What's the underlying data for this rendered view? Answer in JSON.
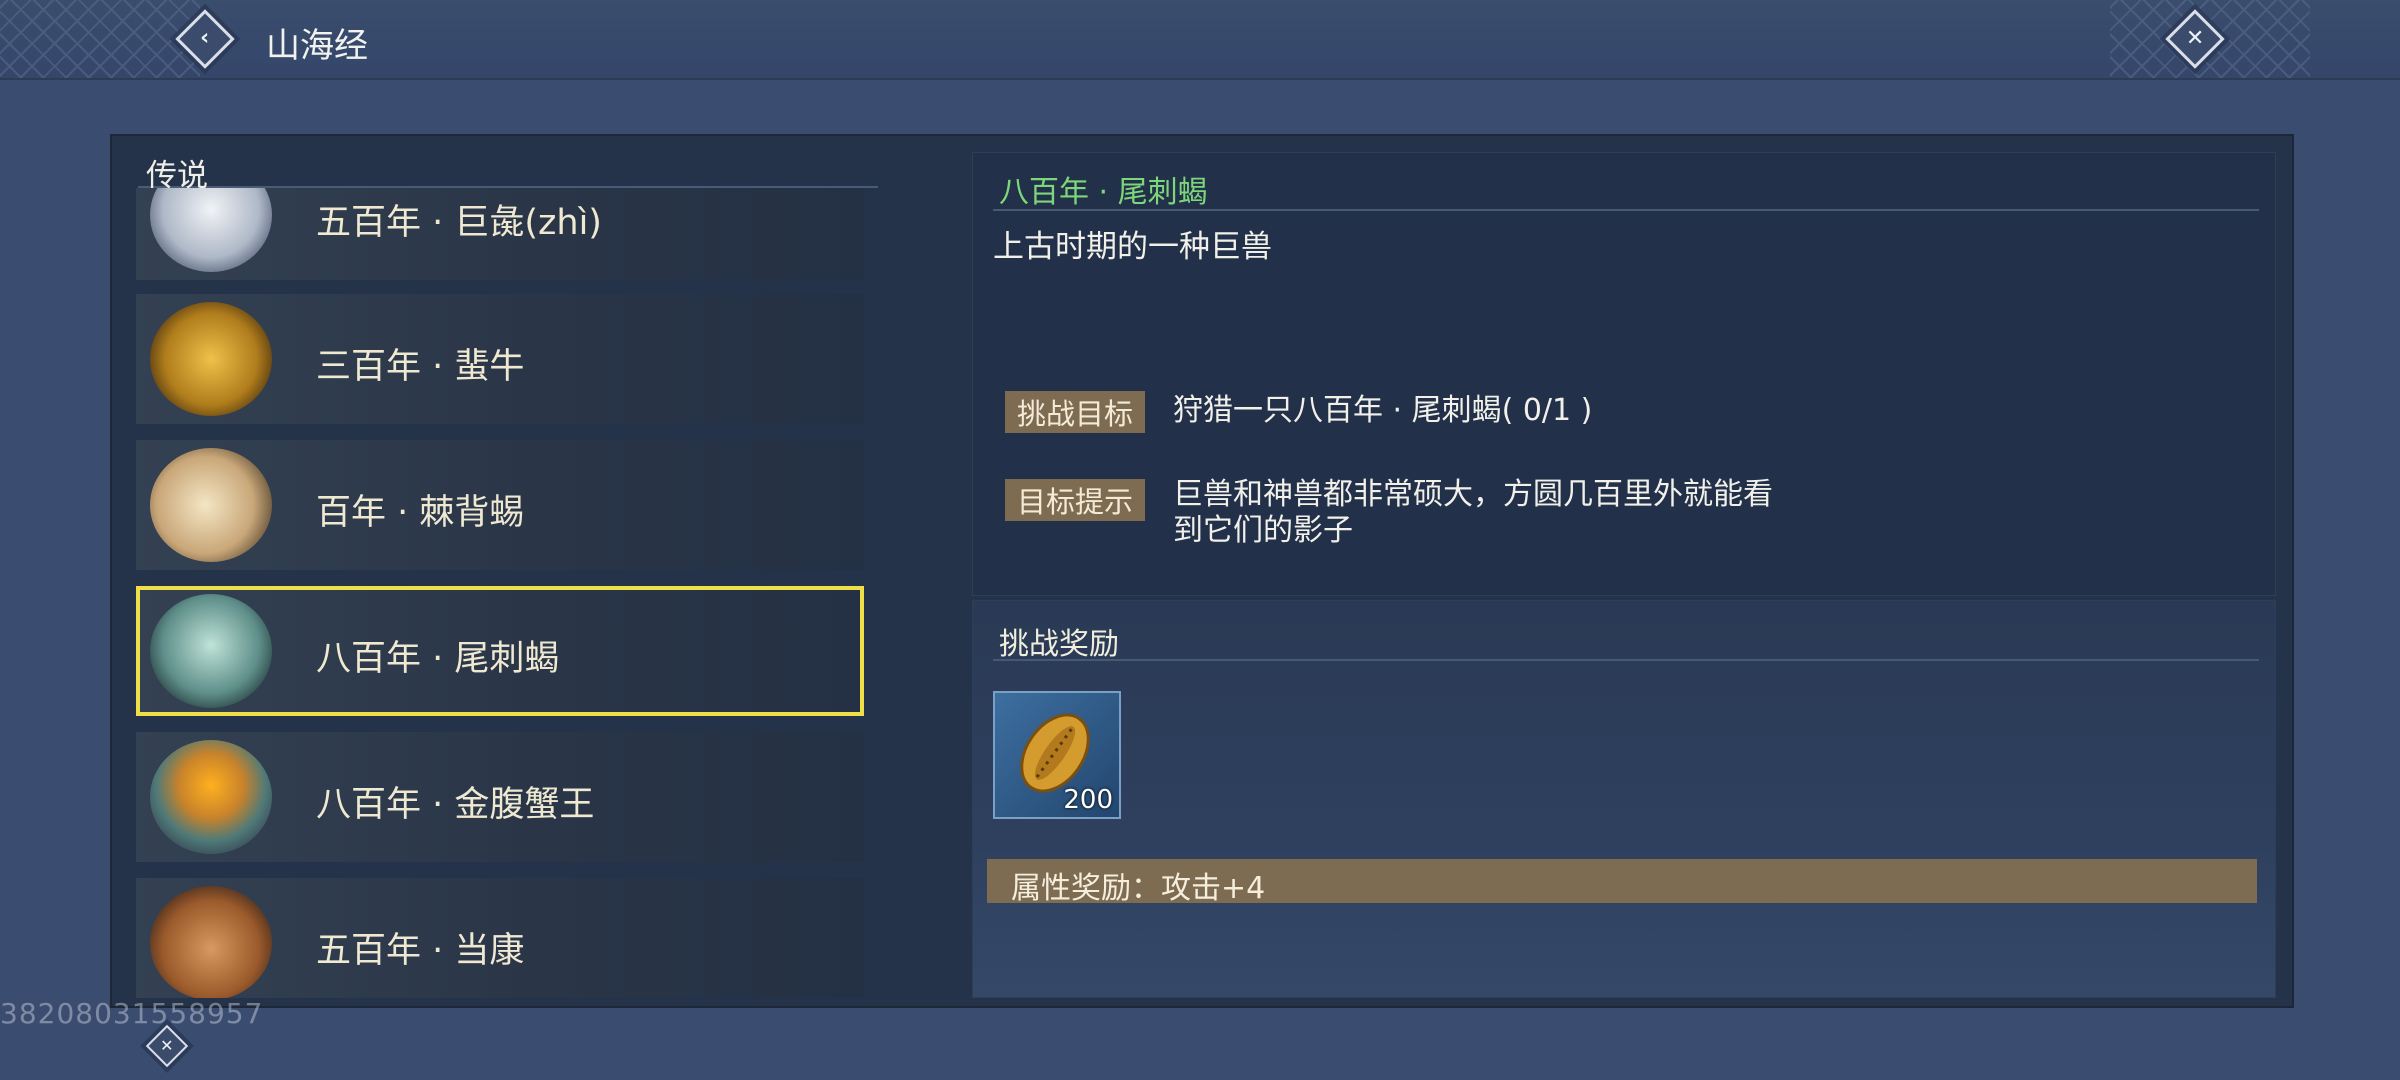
{
  "header": {
    "title": "山海经",
    "back_icon": "back-arrow-icon",
    "close_icon": "close-icon"
  },
  "sidebar": {
    "category": "传说",
    "items": [
      {
        "label": "五百年 · 巨彘(zhì)",
        "icon": "white-beast-portrait",
        "selected": false
      },
      {
        "label": "三百年 · 蜚牛",
        "icon": "golden-bull-portrait",
        "selected": false
      },
      {
        "label": "百年 · 棘背蜴",
        "icon": "spiked-lizard-portrait",
        "selected": false
      },
      {
        "label": "八百年 · 尾刺蝎",
        "icon": "scorpion-portrait",
        "selected": true
      },
      {
        "label": "八百年 · 金腹蟹王",
        "icon": "crab-king-portrait",
        "selected": false
      },
      {
        "label": "五百年 · 当康",
        "icon": "dangkang-portrait",
        "selected": false
      }
    ]
  },
  "detail": {
    "title": "八百年 · 尾刺蝎",
    "description": "上古时期的一种巨兽",
    "goal_label": "挑战目标",
    "goal_text": "狩猎一只八百年 · 尾刺蝎( 0/1 )",
    "hint_label": "目标提示",
    "hint_line1": "巨兽和神兽都非常硕大，方圆几百里外就能看",
    "hint_line2": "到它们的影子"
  },
  "rewards": {
    "title": "挑战奖励",
    "item_icon": "gold-shell-coin-icon",
    "item_count": "200",
    "attribute_text": "属性奖励：攻击+4"
  },
  "watermark": "38208031558957",
  "colors": {
    "selected_border": "#efe04a",
    "title_green": "#7cd67a",
    "tag_bg": "#7d6c52"
  }
}
